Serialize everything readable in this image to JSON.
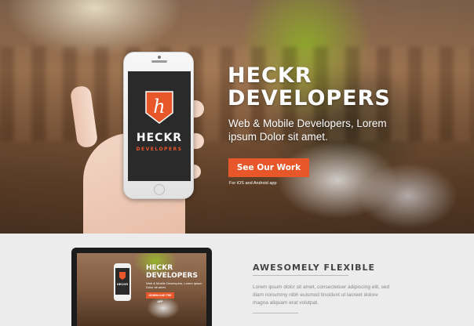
{
  "hero": {
    "title_line1": "HECKR",
    "title_line2": "DEVELOPERS",
    "description": "Web & Mobile Developers, Lorem ipsum Dolor sit amet.",
    "cta_label": "See Our Work",
    "cta_note": "For iOS and Android app",
    "accent_color": "#e8572a"
  },
  "phone_app": {
    "badge_letter": "h",
    "title": "HECKR",
    "subtitle": "DEVELOPERS"
  },
  "feature": {
    "title": "AWESOMELY FLEXIBLE",
    "text": "Lorem ipsum dolor sit amet, consectetuer adipiscing elit, sed diam nonummy nibh euismod tincidunt ut laoreet dolore magna aliquam erat volutpat."
  },
  "laptop_preview": {
    "title_line1": "HECKR",
    "title_line2": "DEVELOPERS",
    "description": "Web & Mobile Developers, Lorem ipsum Dolor sit amet.",
    "cta_label": "DOWNLOAD THE APP",
    "app_title": "HECKR"
  }
}
